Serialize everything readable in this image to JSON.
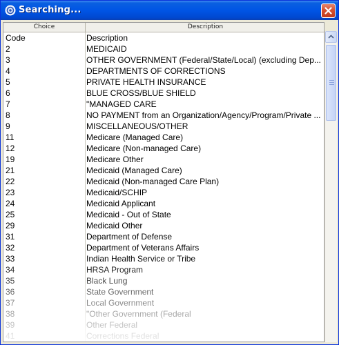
{
  "window": {
    "title": "Searching..."
  },
  "columns": {
    "choice": "Choice",
    "description": "Description"
  },
  "rows": [
    {
      "code": "Code",
      "desc": "Description"
    },
    {
      "code": "2",
      "desc": "MEDICAID"
    },
    {
      "code": "3",
      "desc": "OTHER GOVERNMENT (Federal/State/Local) (excluding Dep..."
    },
    {
      "code": "4",
      "desc": "DEPARTMENTS OF CORRECTIONS"
    },
    {
      "code": "5",
      "desc": "PRIVATE HEALTH INSURANCE"
    },
    {
      "code": "6",
      "desc": "BLUE CROSS/BLUE SHIELD"
    },
    {
      "code": "7",
      "desc": "\"MANAGED CARE"
    },
    {
      "code": "8",
      "desc": "NO PAYMENT from an Organization/Agency/Program/Private ..."
    },
    {
      "code": "9",
      "desc": "MISCELLANEOUS/OTHER"
    },
    {
      "code": "11",
      "desc": "Medicare (Managed Care)"
    },
    {
      "code": "12",
      "desc": "Medicare (Non-managed Care)"
    },
    {
      "code": "19",
      "desc": "Medicare Other"
    },
    {
      "code": "21",
      "desc": "Medicaid (Managed Care)"
    },
    {
      "code": "22",
      "desc": "Medicaid (Non-managed Care Plan)"
    },
    {
      "code": "23",
      "desc": "Medicaid/SCHIP"
    },
    {
      "code": "24",
      "desc": "Medicaid Applicant"
    },
    {
      "code": "25",
      "desc": "Medicaid - Out of State"
    },
    {
      "code": "29",
      "desc": "Medicaid Other"
    },
    {
      "code": "31",
      "desc": "Department of Defense"
    },
    {
      "code": "32",
      "desc": "Department of Veterans Affairs"
    },
    {
      "code": "33",
      "desc": "Indian Health Service or Tribe"
    },
    {
      "code": "34",
      "desc": "HRSA Program"
    },
    {
      "code": "35",
      "desc": "Black Lung"
    },
    {
      "code": "36",
      "desc": "State Government"
    },
    {
      "code": "37",
      "desc": "Local Government"
    },
    {
      "code": "38",
      "desc": "\"Other Government (Federal"
    },
    {
      "code": "39",
      "desc": "Other Federal"
    },
    {
      "code": "41",
      "desc": "Corrections Federal"
    }
  ],
  "icons": {
    "title": "app-search-icon",
    "close": "close-icon"
  },
  "colors": {
    "titlebar": "#0055e5",
    "close": "#d6502f",
    "frame": "#ece9d8"
  }
}
